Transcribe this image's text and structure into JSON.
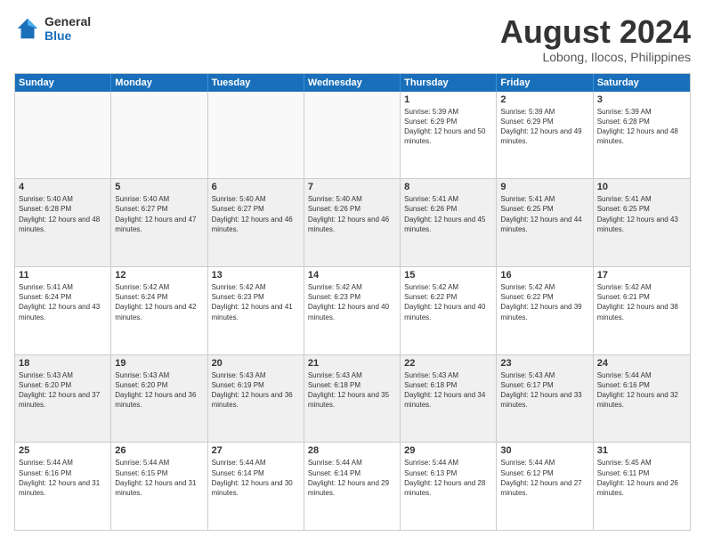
{
  "header": {
    "logo_general": "General",
    "logo_blue": "Blue",
    "month_year": "August 2024",
    "location": "Lobong, Ilocos, Philippines"
  },
  "days_of_week": [
    "Sunday",
    "Monday",
    "Tuesday",
    "Wednesday",
    "Thursday",
    "Friday",
    "Saturday"
  ],
  "weeks": [
    [
      {
        "day": "",
        "text": "",
        "empty": true
      },
      {
        "day": "",
        "text": "",
        "empty": true
      },
      {
        "day": "",
        "text": "",
        "empty": true
      },
      {
        "day": "",
        "text": "",
        "empty": true
      },
      {
        "day": "1",
        "text": "Sunrise: 5:39 AM\nSunset: 6:29 PM\nDaylight: 12 hours and 50 minutes."
      },
      {
        "day": "2",
        "text": "Sunrise: 5:39 AM\nSunset: 6:29 PM\nDaylight: 12 hours and 49 minutes."
      },
      {
        "day": "3",
        "text": "Sunrise: 5:39 AM\nSunset: 6:28 PM\nDaylight: 12 hours and 48 minutes."
      }
    ],
    [
      {
        "day": "4",
        "text": "Sunrise: 5:40 AM\nSunset: 6:28 PM\nDaylight: 12 hours and 48 minutes."
      },
      {
        "day": "5",
        "text": "Sunrise: 5:40 AM\nSunset: 6:27 PM\nDaylight: 12 hours and 47 minutes."
      },
      {
        "day": "6",
        "text": "Sunrise: 5:40 AM\nSunset: 6:27 PM\nDaylight: 12 hours and 46 minutes."
      },
      {
        "day": "7",
        "text": "Sunrise: 5:40 AM\nSunset: 6:26 PM\nDaylight: 12 hours and 46 minutes."
      },
      {
        "day": "8",
        "text": "Sunrise: 5:41 AM\nSunset: 6:26 PM\nDaylight: 12 hours and 45 minutes."
      },
      {
        "day": "9",
        "text": "Sunrise: 5:41 AM\nSunset: 6:25 PM\nDaylight: 12 hours and 44 minutes."
      },
      {
        "day": "10",
        "text": "Sunrise: 5:41 AM\nSunset: 6:25 PM\nDaylight: 12 hours and 43 minutes."
      }
    ],
    [
      {
        "day": "11",
        "text": "Sunrise: 5:41 AM\nSunset: 6:24 PM\nDaylight: 12 hours and 43 minutes."
      },
      {
        "day": "12",
        "text": "Sunrise: 5:42 AM\nSunset: 6:24 PM\nDaylight: 12 hours and 42 minutes."
      },
      {
        "day": "13",
        "text": "Sunrise: 5:42 AM\nSunset: 6:23 PM\nDaylight: 12 hours and 41 minutes."
      },
      {
        "day": "14",
        "text": "Sunrise: 5:42 AM\nSunset: 6:23 PM\nDaylight: 12 hours and 40 minutes."
      },
      {
        "day": "15",
        "text": "Sunrise: 5:42 AM\nSunset: 6:22 PM\nDaylight: 12 hours and 40 minutes."
      },
      {
        "day": "16",
        "text": "Sunrise: 5:42 AM\nSunset: 6:22 PM\nDaylight: 12 hours and 39 minutes."
      },
      {
        "day": "17",
        "text": "Sunrise: 5:42 AM\nSunset: 6:21 PM\nDaylight: 12 hours and 38 minutes."
      }
    ],
    [
      {
        "day": "18",
        "text": "Sunrise: 5:43 AM\nSunset: 6:20 PM\nDaylight: 12 hours and 37 minutes."
      },
      {
        "day": "19",
        "text": "Sunrise: 5:43 AM\nSunset: 6:20 PM\nDaylight: 12 hours and 36 minutes."
      },
      {
        "day": "20",
        "text": "Sunrise: 5:43 AM\nSunset: 6:19 PM\nDaylight: 12 hours and 36 minutes."
      },
      {
        "day": "21",
        "text": "Sunrise: 5:43 AM\nSunset: 6:18 PM\nDaylight: 12 hours and 35 minutes."
      },
      {
        "day": "22",
        "text": "Sunrise: 5:43 AM\nSunset: 6:18 PM\nDaylight: 12 hours and 34 minutes."
      },
      {
        "day": "23",
        "text": "Sunrise: 5:43 AM\nSunset: 6:17 PM\nDaylight: 12 hours and 33 minutes."
      },
      {
        "day": "24",
        "text": "Sunrise: 5:44 AM\nSunset: 6:16 PM\nDaylight: 12 hours and 32 minutes."
      }
    ],
    [
      {
        "day": "25",
        "text": "Sunrise: 5:44 AM\nSunset: 6:16 PM\nDaylight: 12 hours and 31 minutes."
      },
      {
        "day": "26",
        "text": "Sunrise: 5:44 AM\nSunset: 6:15 PM\nDaylight: 12 hours and 31 minutes."
      },
      {
        "day": "27",
        "text": "Sunrise: 5:44 AM\nSunset: 6:14 PM\nDaylight: 12 hours and 30 minutes."
      },
      {
        "day": "28",
        "text": "Sunrise: 5:44 AM\nSunset: 6:14 PM\nDaylight: 12 hours and 29 minutes."
      },
      {
        "day": "29",
        "text": "Sunrise: 5:44 AM\nSunset: 6:13 PM\nDaylight: 12 hours and 28 minutes."
      },
      {
        "day": "30",
        "text": "Sunrise: 5:44 AM\nSunset: 6:12 PM\nDaylight: 12 hours and 27 minutes."
      },
      {
        "day": "31",
        "text": "Sunrise: 5:45 AM\nSunset: 6:11 PM\nDaylight: 12 hours and 26 minutes."
      }
    ]
  ]
}
